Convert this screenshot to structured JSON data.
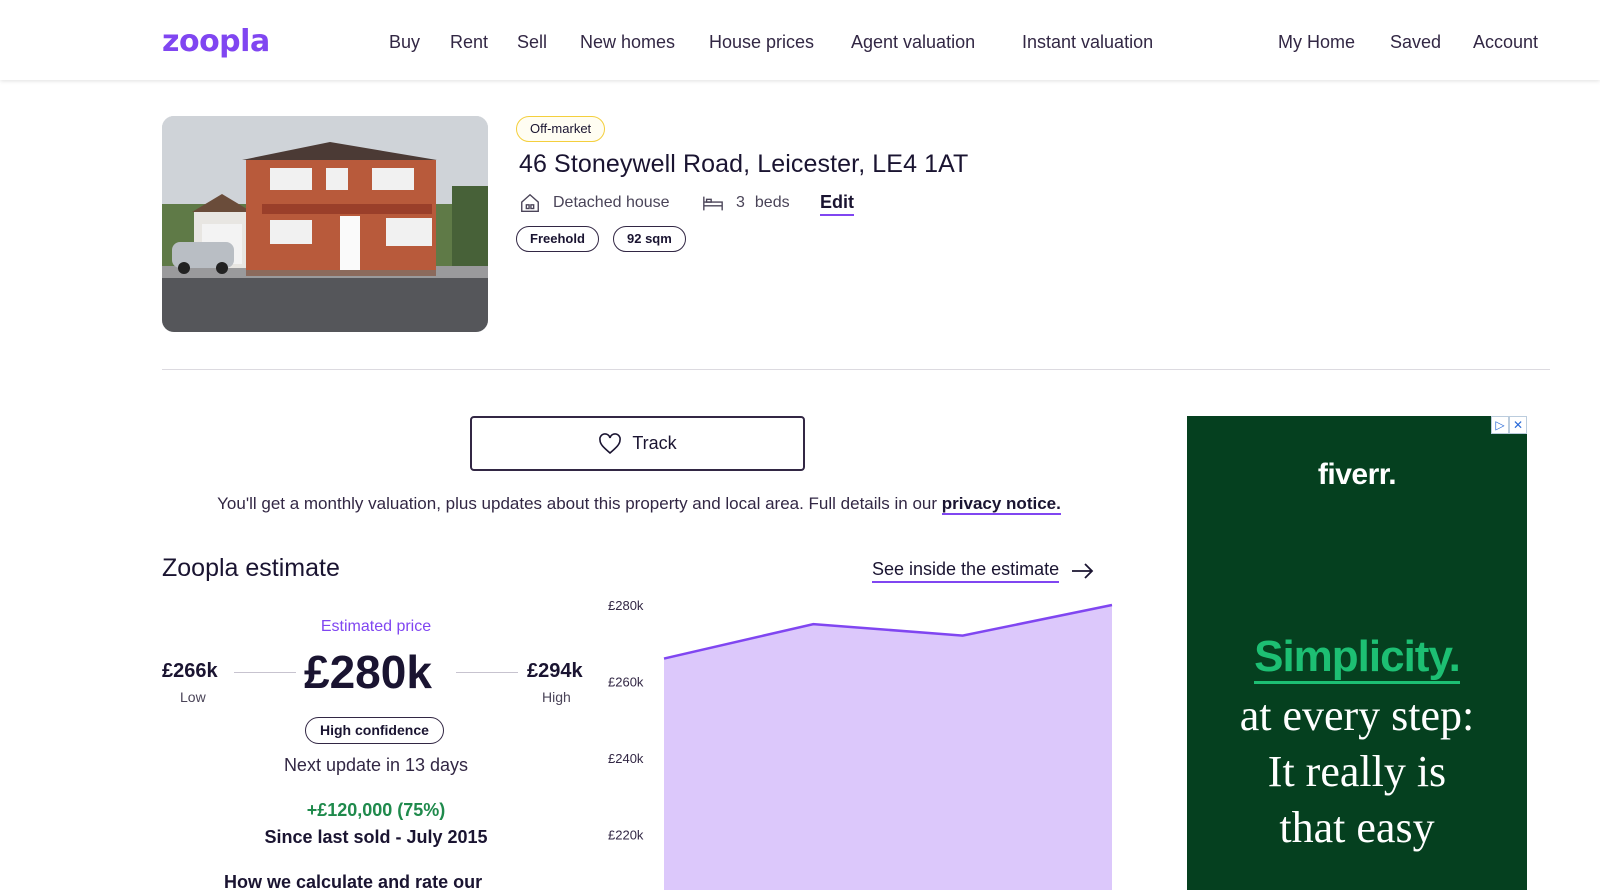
{
  "header": {
    "logo": "zoopla",
    "nav": [
      "Buy",
      "Rent",
      "Sell",
      "New homes",
      "House prices",
      "Agent valuation",
      "Instant valuation"
    ],
    "account_nav": [
      "My Home",
      "Saved",
      "Account"
    ]
  },
  "property": {
    "status_badge": "Off-market",
    "address": "46 Stoneywell Road, Leicester, LE4 1AT",
    "type": "Detached house",
    "beds_count": "3",
    "beds_label": "beds",
    "edit_label": "Edit",
    "tags": [
      "Freehold",
      "92 sqm"
    ]
  },
  "track": {
    "button_label": "Track",
    "notice_text": "You'll get a monthly valuation, plus updates about this property and local area. Full details in our ",
    "privacy_link": "privacy notice."
  },
  "estimate": {
    "title": "Zoopla estimate",
    "see_inside_label": "See inside the estimate",
    "estimated_label": "Estimated price",
    "price": "£280k",
    "low_value": "£266k",
    "low_label": "Low",
    "high_value": "£294k",
    "high_label": "High",
    "confidence": "High confidence",
    "next_update": "Next update in 13 days",
    "change": "+£120,000 (75%)",
    "since": "Since last sold - July 2015",
    "how_calc": "How we calculate and rate our"
  },
  "chart_data": {
    "type": "area",
    "y_ticks": [
      "£280k",
      "£260k",
      "£240k",
      "£220k"
    ],
    "ylim": [
      200,
      280
    ],
    "values": [
      266,
      275,
      272,
      280
    ],
    "color": "#dcc8fb",
    "line_color": "#8046f1"
  },
  "ad": {
    "brand": "fiverr.",
    "headline": "Simplicity.",
    "body_lines": [
      "at every step:",
      "It really is",
      "that easy"
    ],
    "bg_color": "#05401f",
    "accent_color": "#1dbf73"
  }
}
